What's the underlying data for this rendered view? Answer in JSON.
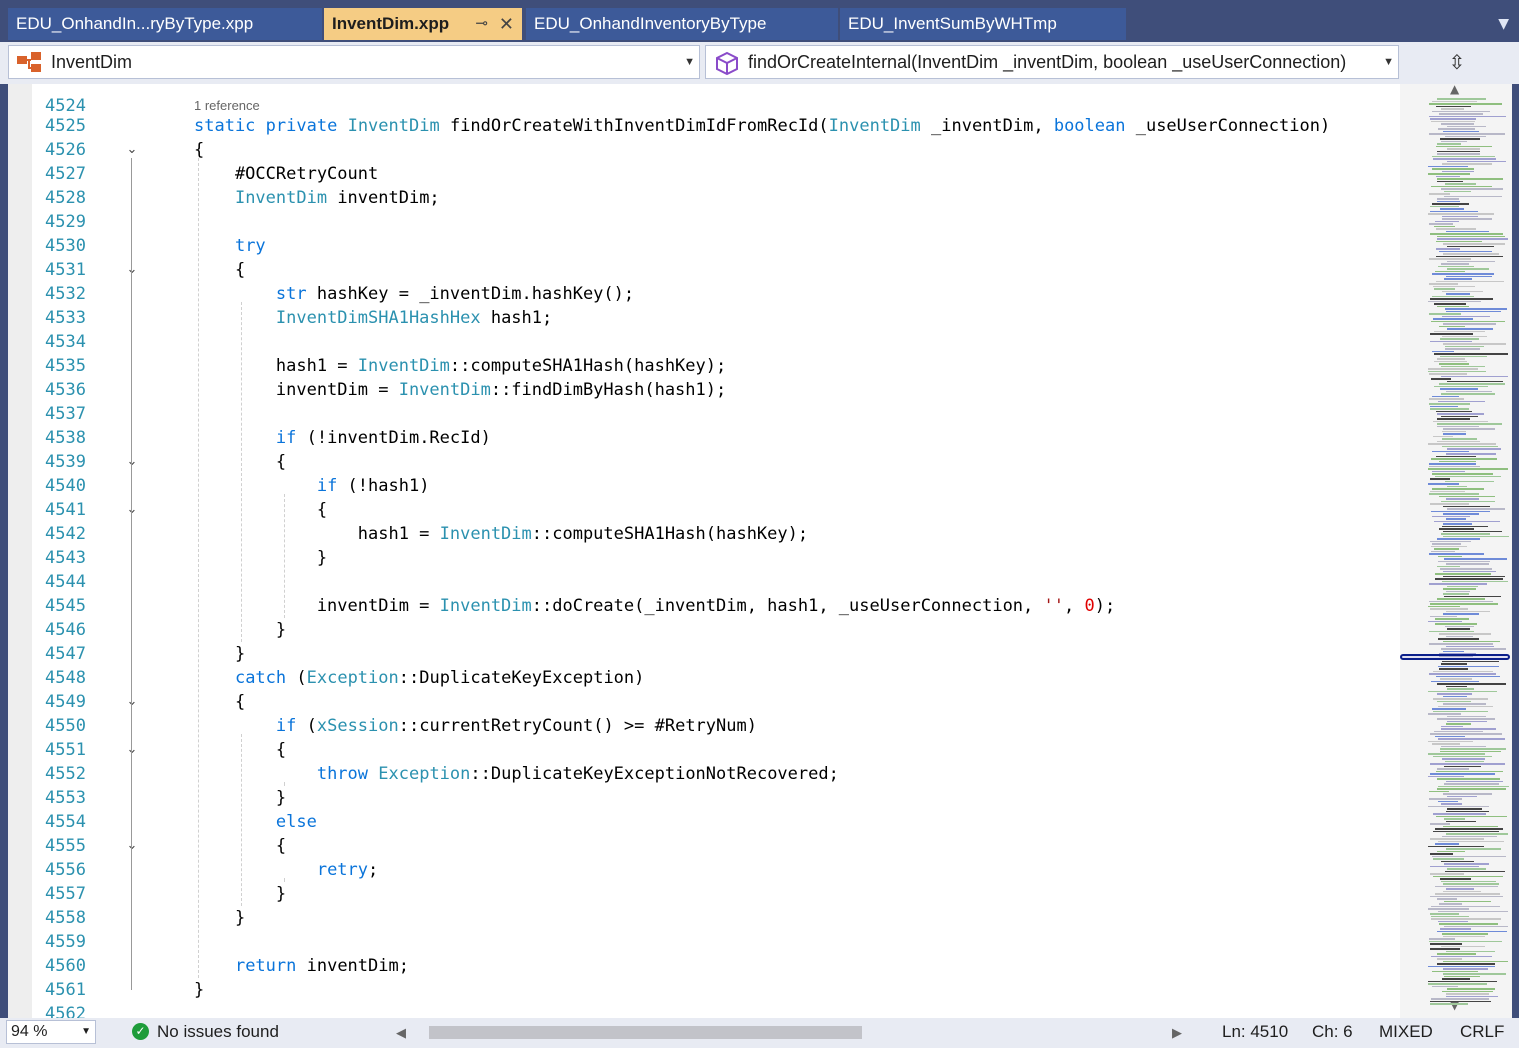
{
  "tabs": [
    {
      "label": "EDU_OnhandIn...ryByType.xpp",
      "active": false
    },
    {
      "label": "InventDim.xpp",
      "active": true,
      "pin_icon": "pin-icon",
      "close_icon": "close-icon"
    },
    {
      "label": "EDU_OnhandInventoryByType",
      "active": false
    },
    {
      "label": "EDU_InventSumByWHTmp",
      "active": false
    }
  ],
  "tab_overflow_icon": "chevron-down-icon",
  "navbar": {
    "class_combo": {
      "value": "InventDim",
      "icon": "class-icon"
    },
    "member_combo": {
      "value": "findOrCreateInternal(InventDim _inventDim, boolean _useUserConnection)",
      "icon": "method-cube-icon"
    },
    "split_icon": "split-editor-icon"
  },
  "editor": {
    "partial_top_line_number": "4524",
    "reference_hint": "1 reference",
    "lines": [
      {
        "n": "4525",
        "tokens": [
          [
            "kw",
            "static"
          ],
          [
            "t",
            " "
          ],
          [
            "kw",
            "private"
          ],
          [
            "t",
            " "
          ],
          [
            "ty",
            "InventDim"
          ],
          [
            "t",
            " findOrCreateWithInventDimIdFromRecId("
          ],
          [
            "ty",
            "InventDim"
          ],
          [
            "t",
            " _inventDim, "
          ],
          [
            "kw",
            "boolean"
          ],
          [
            "t",
            " _useUserConnection)"
          ]
        ]
      },
      {
        "n": "4526",
        "fold": true,
        "tokens": [
          [
            "t",
            "{"
          ]
        ]
      },
      {
        "n": "4527",
        "tokens": [
          [
            "t",
            "    #OCCRetryCount"
          ]
        ]
      },
      {
        "n": "4528",
        "tokens": [
          [
            "t",
            "    "
          ],
          [
            "ty",
            "InventDim"
          ],
          [
            "t",
            " inventDim;"
          ]
        ]
      },
      {
        "n": "4529",
        "tokens": []
      },
      {
        "n": "4530",
        "tokens": [
          [
            "t",
            "    "
          ],
          [
            "kw",
            "try"
          ]
        ]
      },
      {
        "n": "4531",
        "fold": true,
        "tokens": [
          [
            "t",
            "    {"
          ]
        ]
      },
      {
        "n": "4532",
        "tokens": [
          [
            "t",
            "        "
          ],
          [
            "kw",
            "str"
          ],
          [
            "t",
            " hashKey = _inventDim.hashKey();"
          ]
        ]
      },
      {
        "n": "4533",
        "tokens": [
          [
            "t",
            "        "
          ],
          [
            "ty",
            "InventDimSHA1HashHex"
          ],
          [
            "t",
            " hash1;"
          ]
        ]
      },
      {
        "n": "4534",
        "tokens": []
      },
      {
        "n": "4535",
        "tokens": [
          [
            "t",
            "        hash1 = "
          ],
          [
            "ty",
            "InventDim"
          ],
          [
            "t",
            "::computeSHA1Hash(hashKey);"
          ]
        ]
      },
      {
        "n": "4536",
        "tokens": [
          [
            "t",
            "        inventDim = "
          ],
          [
            "ty",
            "InventDim"
          ],
          [
            "t",
            "::findDimByHash(hash1);"
          ]
        ]
      },
      {
        "n": "4537",
        "tokens": []
      },
      {
        "n": "4538",
        "tokens": [
          [
            "t",
            "        "
          ],
          [
            "kw",
            "if"
          ],
          [
            "t",
            " (!inventDim.RecId)"
          ]
        ]
      },
      {
        "n": "4539",
        "fold": true,
        "tokens": [
          [
            "t",
            "        {"
          ]
        ]
      },
      {
        "n": "4540",
        "tokens": [
          [
            "t",
            "            "
          ],
          [
            "kw",
            "if"
          ],
          [
            "t",
            " (!hash1)"
          ]
        ]
      },
      {
        "n": "4541",
        "fold": true,
        "tokens": [
          [
            "t",
            "            {"
          ]
        ]
      },
      {
        "n": "4542",
        "tokens": [
          [
            "t",
            "                hash1 = "
          ],
          [
            "ty",
            "InventDim"
          ],
          [
            "t",
            "::computeSHA1Hash(hashKey);"
          ]
        ]
      },
      {
        "n": "4543",
        "tokens": [
          [
            "t",
            "            }"
          ]
        ]
      },
      {
        "n": "4544",
        "tokens": []
      },
      {
        "n": "4545",
        "tokens": [
          [
            "t",
            "            inventDim = "
          ],
          [
            "ty",
            "InventDim"
          ],
          [
            "t",
            "::doCreate(_inventDim, hash1, _useUserConnection, "
          ],
          [
            "str",
            "''"
          ],
          [
            "t",
            ", "
          ],
          [
            "num",
            "0"
          ],
          [
            "t",
            ");"
          ]
        ]
      },
      {
        "n": "4546",
        "tokens": [
          [
            "t",
            "        }"
          ]
        ]
      },
      {
        "n": "4547",
        "tokens": [
          [
            "t",
            "    }"
          ]
        ]
      },
      {
        "n": "4548",
        "tokens": [
          [
            "t",
            "    "
          ],
          [
            "kw",
            "catch"
          ],
          [
            "t",
            " ("
          ],
          [
            "ty",
            "Exception"
          ],
          [
            "t",
            "::DuplicateKeyException)"
          ]
        ]
      },
      {
        "n": "4549",
        "fold": true,
        "tokens": [
          [
            "t",
            "    {"
          ]
        ]
      },
      {
        "n": "4550",
        "tokens": [
          [
            "t",
            "        "
          ],
          [
            "kw",
            "if"
          ],
          [
            "t",
            " ("
          ],
          [
            "ty",
            "xSession"
          ],
          [
            "t",
            "::currentRetryCount() >= #RetryNum)"
          ]
        ]
      },
      {
        "n": "4551",
        "fold": true,
        "tokens": [
          [
            "t",
            "        {"
          ]
        ]
      },
      {
        "n": "4552",
        "tokens": [
          [
            "t",
            "            "
          ],
          [
            "kw",
            "throw"
          ],
          [
            "t",
            " "
          ],
          [
            "ty",
            "Exception"
          ],
          [
            "t",
            "::DuplicateKeyExceptionNotRecovered;"
          ]
        ]
      },
      {
        "n": "4553",
        "tokens": [
          [
            "t",
            "        }"
          ]
        ]
      },
      {
        "n": "4554",
        "tokens": [
          [
            "t",
            "        "
          ],
          [
            "kw",
            "else"
          ]
        ]
      },
      {
        "n": "4555",
        "fold": true,
        "tokens": [
          [
            "t",
            "        {"
          ]
        ]
      },
      {
        "n": "4556",
        "tokens": [
          [
            "t",
            "            "
          ],
          [
            "kw",
            "retry"
          ],
          [
            "t",
            ";"
          ]
        ]
      },
      {
        "n": "4557",
        "tokens": [
          [
            "t",
            "        }"
          ]
        ]
      },
      {
        "n": "4558",
        "tokens": [
          [
            "t",
            "    }"
          ]
        ]
      },
      {
        "n": "4559",
        "tokens": []
      },
      {
        "n": "4560",
        "tokens": [
          [
            "t",
            "    "
          ],
          [
            "kw",
            "return"
          ],
          [
            "t",
            " inventDim;"
          ]
        ]
      },
      {
        "n": "4561",
        "tokens": [
          [
            "t",
            "}"
          ]
        ]
      },
      {
        "n": "4562",
        "tokens": []
      }
    ]
  },
  "minimap": {
    "scroll_position": 0.61,
    "up_icon": "triangle-up-icon",
    "down_icon": "triangle-down-icon"
  },
  "status": {
    "zoom": "94 %",
    "issues_icon": "check-circle-icon",
    "issues": "No issues found",
    "horizontal_scroll_thumb": {
      "start": 0.02,
      "size": 0.57
    },
    "line": "Ln: 4510",
    "column": "Ch: 6",
    "encoding": "MIXED",
    "line_endings": "CRLF"
  },
  "colors": {
    "keyword": "#0a74da",
    "type": "#2b91af",
    "number": "#e00000",
    "string": "#a31515",
    "active_tab": "#f5cc84",
    "tab": "#3d5a99",
    "frame": "#3f4e7a"
  }
}
